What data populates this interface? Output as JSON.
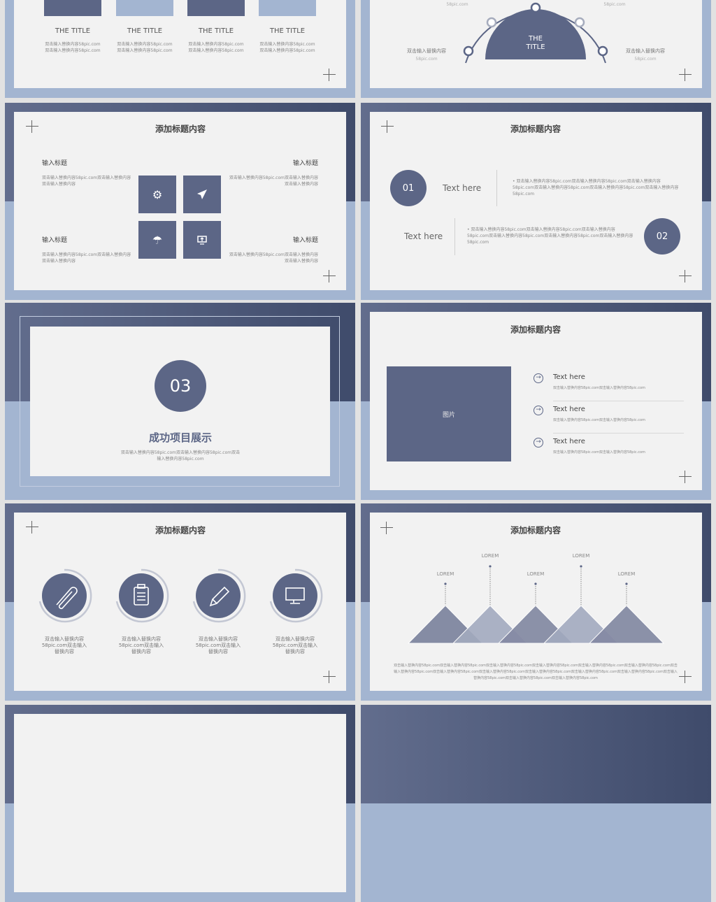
{
  "colors": {
    "navy": "#5c6686",
    "light_blue": "#a3b5d1",
    "panel": "#f2f2f2",
    "page": "#e2e2e2"
  },
  "slide1": {
    "items": [
      {
        "title": "THE TITLE",
        "line1": "双击输入替换内容58pic.com",
        "line2": "双击输入替换内容58pic.com"
      },
      {
        "title": "THE TITLE",
        "line1": "双击输入替换内容58pic.com",
        "line2": "双击输入替换内容58pic.com"
      },
      {
        "title": "THE TITLE",
        "line1": "双击输入替换内容58pic.com",
        "line2": "双击输入替换内容58pic.com"
      },
      {
        "title": "THE TITLE",
        "line1": "双击输入替换内容58pic.com",
        "line2": "双击输入替换内容58pic.com"
      }
    ]
  },
  "slide2": {
    "center_line1": "THE",
    "center_line2": "TITLE",
    "top_left": "58pic.com",
    "top_right": "58pic.com",
    "left_label": "双击输入替换内容",
    "left_sub": "58pic.com",
    "right_label": "双击输入替换内容",
    "right_sub": "58pic.com"
  },
  "slide3": {
    "title": "添加标题内容",
    "blocks": [
      {
        "heading": "输入标题",
        "text": "双击输入替换内容58pic.com双击输入替换内容双击输入替换内容"
      },
      {
        "heading": "输入标题",
        "text": "双击输入替换内容58pic.com双击输入替换内容双击输入替换内容"
      },
      {
        "heading": "输入标题",
        "text": "双击输入替换内容58pic.com双击输入替换内容双击输入替换内容"
      },
      {
        "heading": "输入标题",
        "text": "双击输入替换内容58pic.com双击输入替换内容双击输入替换内容"
      }
    ],
    "icons": [
      "gear-icon",
      "paper-plane-icon",
      "umbrella-icon",
      "monitor-upload-icon"
    ]
  },
  "slide4": {
    "title": "添加标题内容",
    "rows": [
      {
        "num": "01",
        "label": "Text here",
        "text": "双击输入替换内容58pic.com双击输入替换内容58pic.com双击输入替换内容58pic.com双击输入替换内容58pic.com双击输入替换内容58pic.com双击输入替换内容58pic.com"
      },
      {
        "num": "02",
        "label": "Text here",
        "text": "双击输入替换内容58pic.com双击输入替换内容58pic.com双击输入替换内容58pic.com双击输入替换内容58pic.com双击输入替换内容58pic.com双击输入替换内容58pic.com"
      }
    ]
  },
  "slide5": {
    "num": "03",
    "title": "成功项目展示",
    "text": "双击输入替换内容58pic.com双击输入替换内容58pic.com双击输入替换内容58pic.com"
  },
  "slide6": {
    "title": "添加标题内容",
    "image_label": "图片",
    "items": [
      {
        "title": "Text here",
        "text": "双击输入替换内容58pic.com双击输入替换内容58pic.com"
      },
      {
        "title": "Text here",
        "text": "双击输入替换内容58pic.com双击输入替换内容58pic.com"
      },
      {
        "title": "Text here",
        "text": "双击输入替换内容58pic.com双击输入替换内容58pic.com"
      }
    ]
  },
  "slide7": {
    "title": "添加标题内容",
    "icons": [
      "paperclip-icon",
      "clipboard-icon",
      "pencil-icon",
      "monitor-icon"
    ],
    "texts": [
      "双击输入替换内容58pic.com双击输入替换内容",
      "双击输入替换内容58pic.com双击输入替换内容",
      "双击输入替换内容58pic.com双击输入替换内容",
      "双击输入替换内容58pic.com双击输入替换内容"
    ]
  },
  "slide8": {
    "title": "添加标题内容",
    "labels": [
      "LOREM",
      "LOREM",
      "LOREM",
      "LOREM",
      "LOREM"
    ],
    "text": "双击输入替换内容58pic.com双击输入替换内容58pic.com双击输入替换内容58pic.com双击输入替换内容58pic.com双击输入替换内容58pic.com双击输入替换内容58pic.com双击输入替换内容58pic.com双击输入替换内容58pic.com双击输入替换内容58pic.com双击输入替换内容58pic.com双击输入替换内容58pic.com双击输入替换内容58pic.com双击输入替换内容58pic.com双击输入替换内容58pic.com双击输入替换内容58pic.com"
  }
}
